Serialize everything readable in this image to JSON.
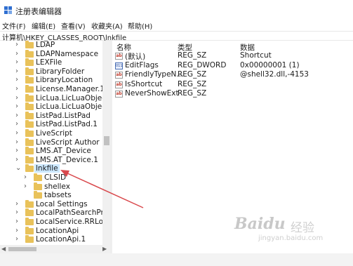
{
  "window": {
    "title": "注册表编辑器"
  },
  "menu": [
    {
      "label": "文件(F)"
    },
    {
      "label": "编辑(E)"
    },
    {
      "label": "查看(V)"
    },
    {
      "label": "收藏夹(A)"
    },
    {
      "label": "帮助(H)"
    }
  ],
  "address": {
    "path": "计算机\\HKEY_CLASSES_ROOT\\lnkfile"
  },
  "tree": {
    "items": [
      {
        "label": "LDAP",
        "expander": "›",
        "indent": 0
      },
      {
        "label": "LDAPNamespace",
        "expander": "›",
        "indent": 0
      },
      {
        "label": "LEXFile",
        "expander": "›",
        "indent": 0
      },
      {
        "label": "LibraryFolder",
        "expander": "›",
        "indent": 0
      },
      {
        "label": "LibraryLocation",
        "expander": "›",
        "indent": 0
      },
      {
        "label": "License.Manager.1",
        "expander": "›",
        "indent": 0
      },
      {
        "label": "LicLua.LicLuaObject",
        "expander": "›",
        "indent": 0
      },
      {
        "label": "LicLua.LicLuaObject.16",
        "expander": "›",
        "indent": 0
      },
      {
        "label": "ListPad.ListPad",
        "expander": "›",
        "indent": 0
      },
      {
        "label": "ListPad.ListPad.1",
        "expander": "›",
        "indent": 0
      },
      {
        "label": "LiveScript",
        "expander": "›",
        "indent": 0
      },
      {
        "label": "LiveScript Author",
        "expander": "›",
        "indent": 0
      },
      {
        "label": "LMS.AT_Device",
        "expander": "›",
        "indent": 0
      },
      {
        "label": "LMS.AT_Device.1",
        "expander": "›",
        "indent": 0
      },
      {
        "label": "lnkfile",
        "expander": "⌄",
        "indent": 0,
        "selected": true
      },
      {
        "label": "CLSID",
        "expander": "›",
        "indent": 1
      },
      {
        "label": "shellex",
        "expander": "›",
        "indent": 1
      },
      {
        "label": "tabsets",
        "expander": "",
        "indent": 1
      },
      {
        "label": "Local Settings",
        "expander": "›",
        "indent": 0
      },
      {
        "label": "LocalPathSearchProvic",
        "expander": "›",
        "indent": 0
      },
      {
        "label": "LocalService.RRLocalSe",
        "expander": "›",
        "indent": 0
      },
      {
        "label": "LocationApi",
        "expander": "›",
        "indent": 0
      },
      {
        "label": "LocationApi.1",
        "expander": "›",
        "indent": 0
      }
    ]
  },
  "list": {
    "columns": {
      "name": "名称",
      "type": "类型",
      "data": "数据"
    },
    "rows": [
      {
        "icon": "string-value-icon",
        "name": "(默认)",
        "type": "REG_SZ",
        "data": "Shortcut"
      },
      {
        "icon": "binary-value-icon",
        "name": "EditFlags",
        "type": "REG_DWORD",
        "data": "0x00000001 (1)"
      },
      {
        "icon": "string-value-icon",
        "name": "FriendlyTypeN...",
        "type": "REG_SZ",
        "data": "@shell32.dll,-4153"
      },
      {
        "icon": "string-value-icon",
        "name": "IsShortcut",
        "type": "REG_SZ",
        "data": ""
      },
      {
        "icon": "string-value-icon",
        "name": "NeverShowExt",
        "type": "REG_SZ",
        "data": ""
      }
    ]
  },
  "annotation": {
    "arrow_color": "#d9484c"
  },
  "watermark": {
    "logo": "Baidu",
    "sub": "经验",
    "url": "jingyan.baidu.com"
  }
}
